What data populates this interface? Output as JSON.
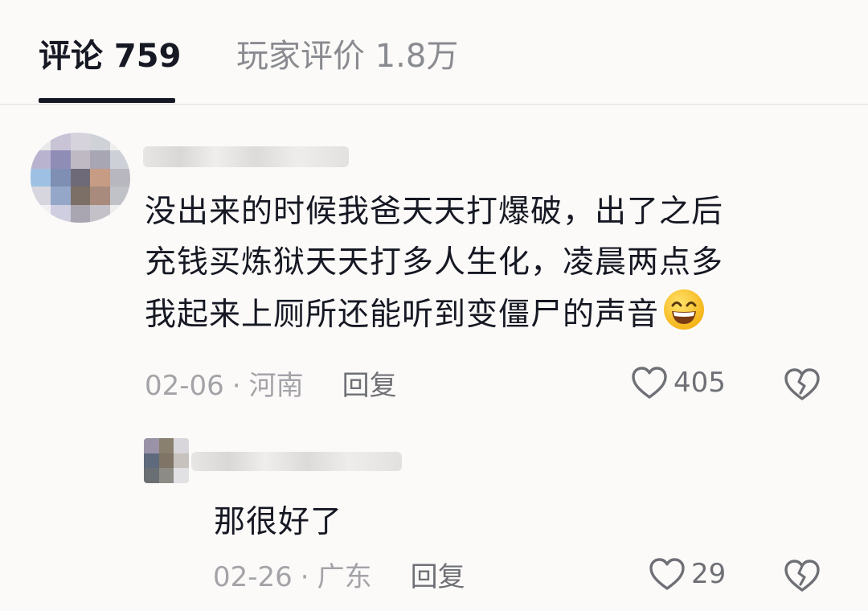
{
  "tabs": {
    "comments_label": "评论 759",
    "reviews_label": "玩家评价 1.8万"
  },
  "comment": {
    "lines": [
      "没出来的时候我爸天天打爆破，出了之后",
      "充钱买炼狱天天打多人生化，凌晨两点多",
      "我起来上厕所还能听到变僵尸的声音"
    ],
    "emoji": "grinning-face-icon",
    "date": "02-06",
    "location": "河南",
    "reply_label": "回复",
    "likes": "405"
  },
  "reply": {
    "text": "那很好了",
    "date": "02-26",
    "location": "广东",
    "reply_label": "回复",
    "likes": "29"
  },
  "colors": {
    "background": "#fbfaf8",
    "text": "#161823",
    "muted": "#a3a3a8",
    "icon": "#6f7076"
  }
}
